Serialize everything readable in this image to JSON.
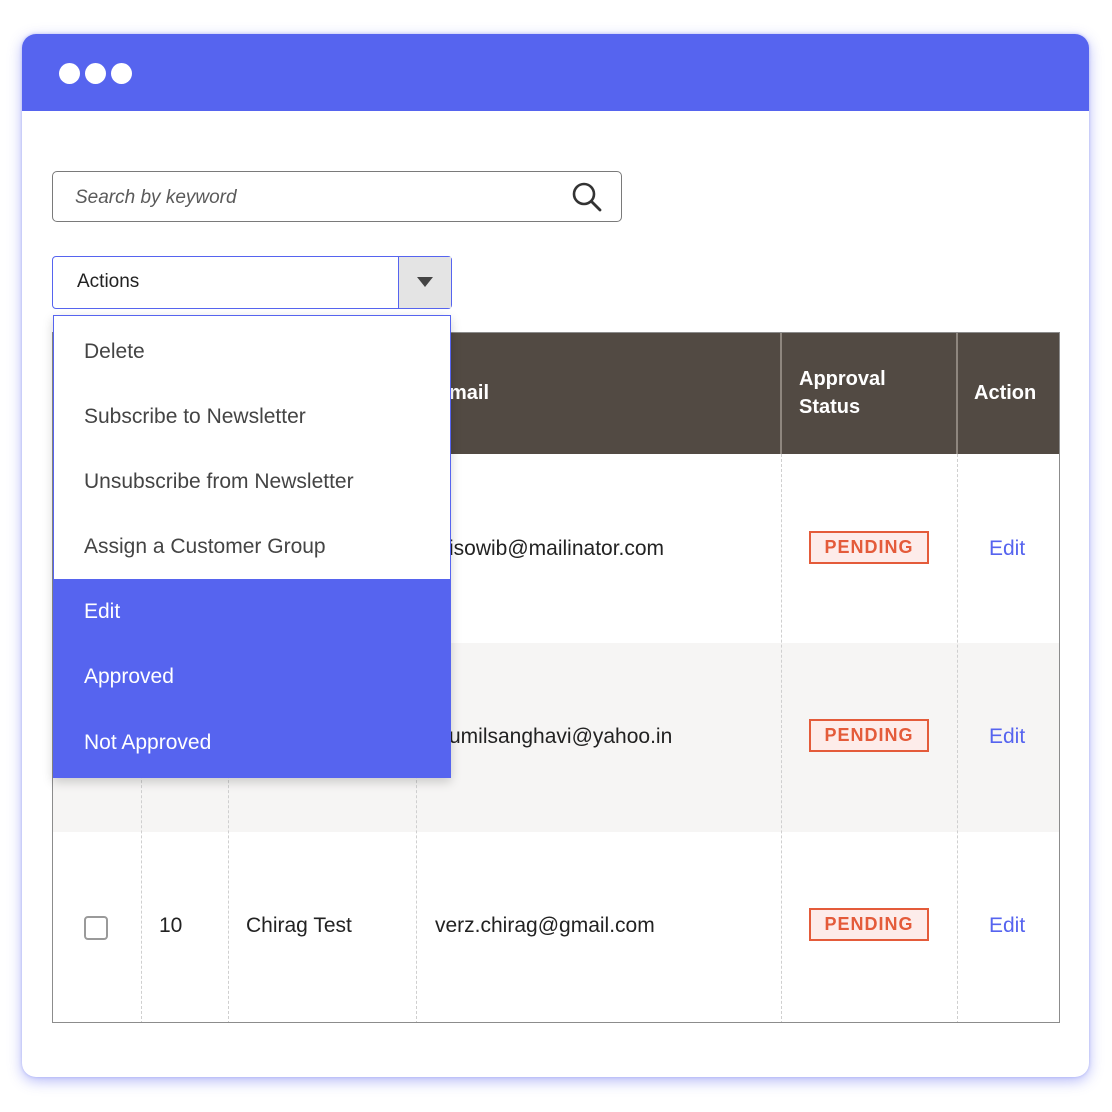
{
  "search": {
    "placeholder": "Search by keyword"
  },
  "actions": {
    "label": "Actions",
    "menu_items": [
      "Delete",
      "Subscribe to Newsletter",
      "Unsubscribe from Newsletter",
      "Assign a Customer Group",
      "Edit",
      "Approved",
      "Not Approved"
    ]
  },
  "table": {
    "headers": {
      "email": "mail",
      "approval_status_line1": "Approval",
      "approval_status_line2": "Status",
      "action": "Action"
    },
    "rows": [
      {
        "email": "isowib@mailinator.com",
        "status": "PENDING",
        "action": "Edit"
      },
      {
        "email": "umilsanghavi@yahoo.in",
        "status": "PENDING",
        "action": "Edit"
      },
      {
        "id": "10",
        "name": "Chirag Test",
        "email": "verz.chirag@gmail.com",
        "status": "PENDING",
        "action": "Edit"
      }
    ]
  },
  "colors": {
    "accent": "#5664ef",
    "header_bg": "#524a43",
    "badge": "#e45b3a",
    "row_alt": "#f6f5f4"
  },
  "icons": {
    "search": "search-icon",
    "dropdown": "caret-down-icon",
    "window_controls": "window-dot-icon"
  }
}
